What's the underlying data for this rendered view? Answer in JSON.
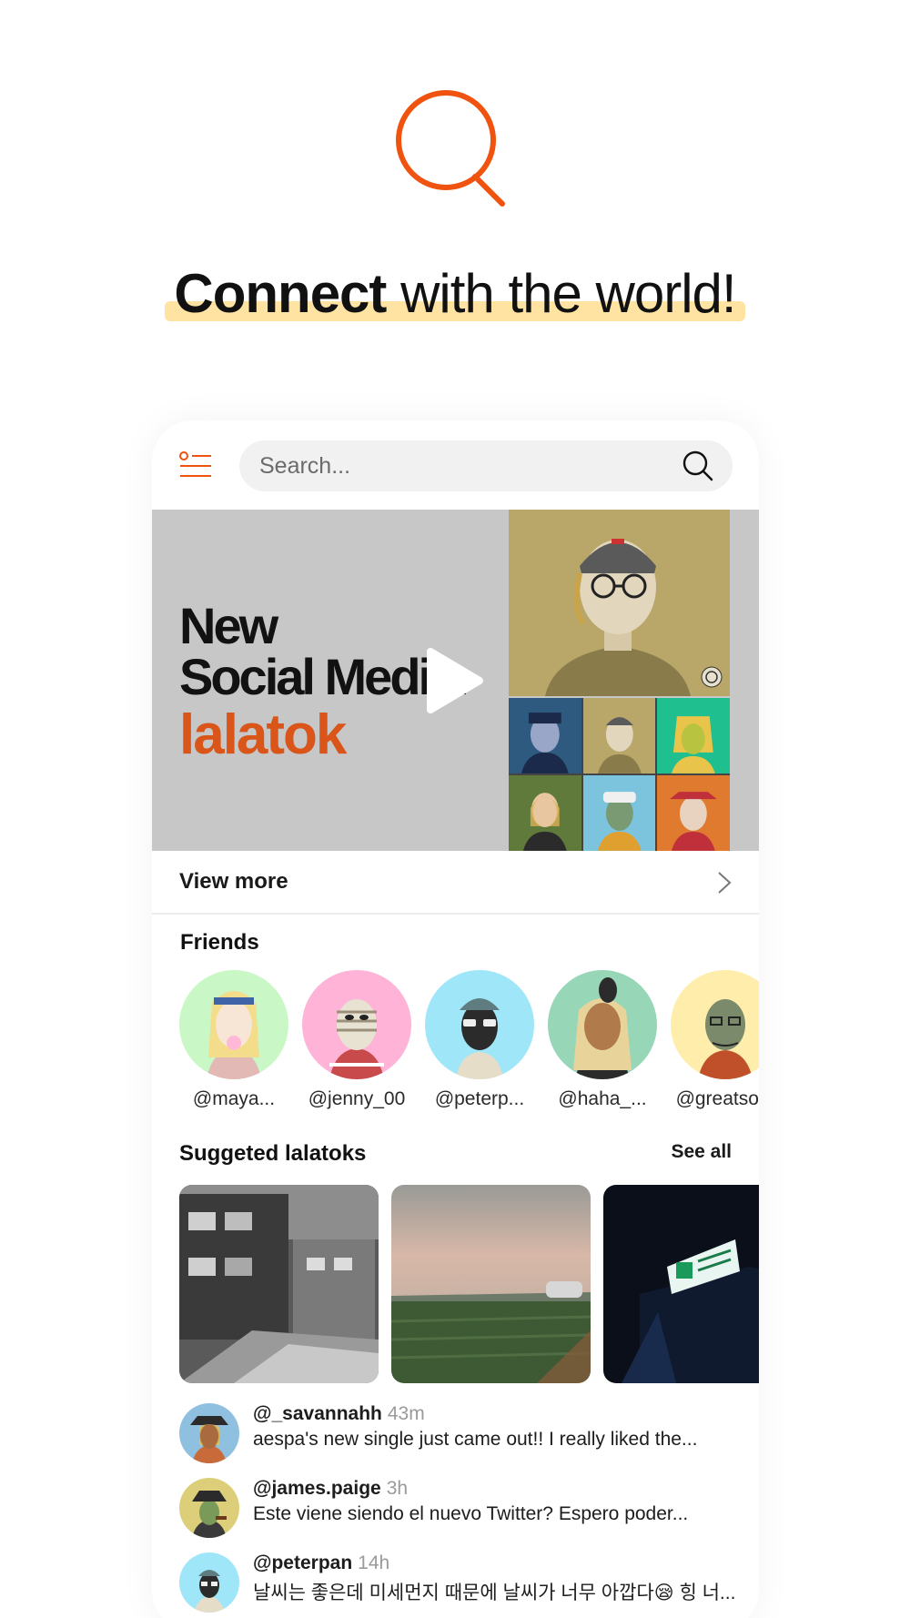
{
  "hero": {
    "icon": "search-icon",
    "headline_bold": "Connect",
    "headline_rest": " with the world!",
    "accent_color": "#f0520f",
    "highlight_color": "#ffe3a3"
  },
  "topbar": {
    "menu_icon": "list-menu-icon",
    "search_placeholder": "Search...",
    "search_icon": "search-icon"
  },
  "banner": {
    "title_line1": "New",
    "title_line2": "Social Media.",
    "brand": "lalatok",
    "play_icon": "play-icon"
  },
  "view_more": {
    "label": "View more",
    "icon": "chevron-right-icon"
  },
  "friends": {
    "title": "Friends",
    "items": [
      {
        "handle": "@maya...",
        "bg": "#c9f7c6"
      },
      {
        "handle": "@jenny_00",
        "bg": "#ffb3d6"
      },
      {
        "handle": "@peterp...",
        "bg": "#9fe6f8"
      },
      {
        "handle": "@haha_...",
        "bg": "#97d6b7"
      },
      {
        "handle": "@greatso...",
        "bg": "#ffedab"
      }
    ]
  },
  "suggested": {
    "title": "Suggeted lalatoks",
    "see_all": "See all"
  },
  "posts": [
    {
      "user": "@_savannahh",
      "time": "43m",
      "text": "aespa's new single just came out!! I really liked the..."
    },
    {
      "user": "@james.paige",
      "time": "3h",
      "text": "Este viene siendo el nuevo Twitter? Espero poder..."
    },
    {
      "user": "@peterpan",
      "time": "14h",
      "text": "날씨는 좋은데 미세먼지 때문에 날씨가 너무 아깝다😪 힝 너..."
    }
  ]
}
